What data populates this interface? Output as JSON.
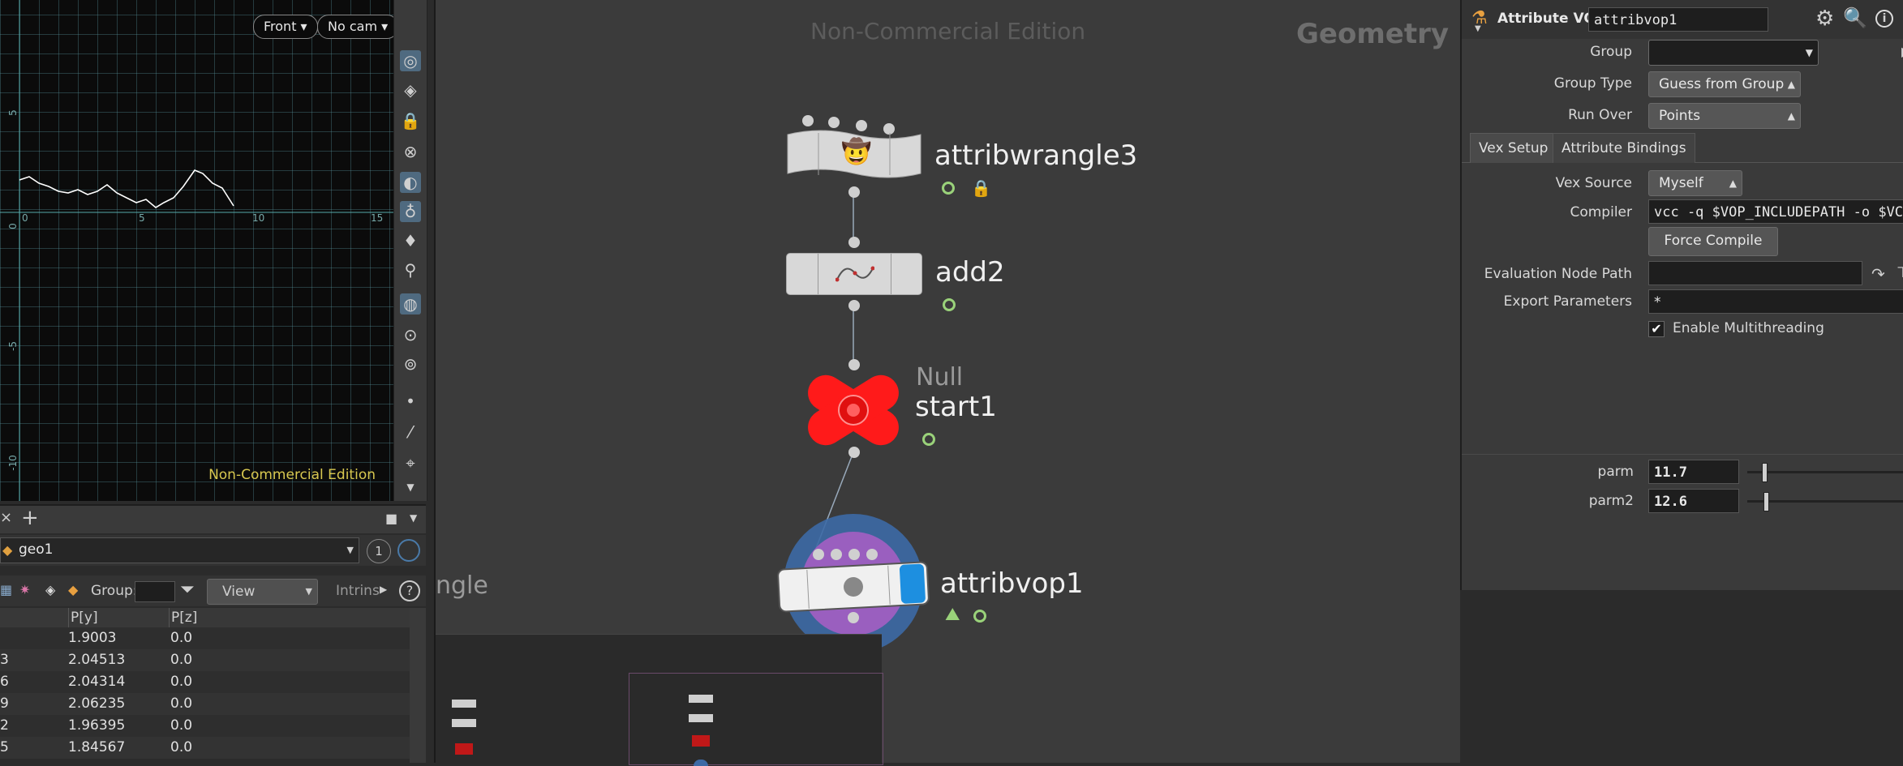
{
  "viewport": {
    "view_button": "Front",
    "cam_button": "No cam",
    "x_ticks": [
      "0",
      "5",
      "10",
      "15"
    ],
    "y_ticks": [
      "5",
      "0",
      "-5",
      "-10"
    ],
    "watermark": "Non-Commercial Edition"
  },
  "spreadsheet": {
    "node_path": "geo1",
    "node_count": "1",
    "group_label": "Group:",
    "view_menu": "View",
    "intrinsics_label": "Intrins",
    "columns": [
      "",
      "P[y]",
      "P[z]"
    ],
    "rows": [
      [
        "",
        "1.9003",
        "0.0"
      ],
      [
        "3",
        "2.04513",
        "0.0"
      ],
      [
        "6",
        "2.04314",
        "0.0"
      ],
      [
        "9",
        "2.06235",
        "0.0"
      ],
      [
        "2",
        "1.96395",
        "0.0"
      ],
      [
        "5",
        "1.84567",
        "0.0"
      ]
    ]
  },
  "network": {
    "watermark": "Non-Commercial Edition",
    "context_label": "Geometry",
    "partial_label": "ngle",
    "nodes": {
      "attribwrangle": "attribwrangle3",
      "add": "add2",
      "null_type": "Null",
      "null_name": "start1",
      "attribvop": "attribvop1"
    }
  },
  "params": {
    "node_type": "Attribute VOP",
    "node_name": "attribvop1",
    "group_label": "Group",
    "group_value": "",
    "group_type_label": "Group Type",
    "group_type_value": "Guess from Group",
    "run_over_label": "Run Over",
    "run_over_value": "Points",
    "tabs": [
      "Vex Setup",
      "Attribute Bindings"
    ],
    "vex_source_label": "Vex Source",
    "vex_source_value": "Myself",
    "compiler_label": "Compiler",
    "compiler_value": "vcc -q $VOP_INCLUDEPATH -o $VC",
    "force_compile_label": "Force Compile",
    "eval_node_path_label": "Evaluation Node Path",
    "eval_node_path_value": "",
    "export_params_label": "Export Parameters",
    "export_params_value": "*",
    "multithreading_label": "Enable Multithreading",
    "multithreading_checked": true,
    "parm_label": "parm",
    "parm_value": "11.7",
    "parm2_label": "parm2",
    "parm2_value": "12.6"
  },
  "colors": {
    "null_node": "#ff1a1a",
    "vop_ring": "#3d6aa6",
    "vop_inner": "#9a5fbf",
    "clock": "#9ad27a",
    "vop_accent": "#1d8fe0"
  }
}
